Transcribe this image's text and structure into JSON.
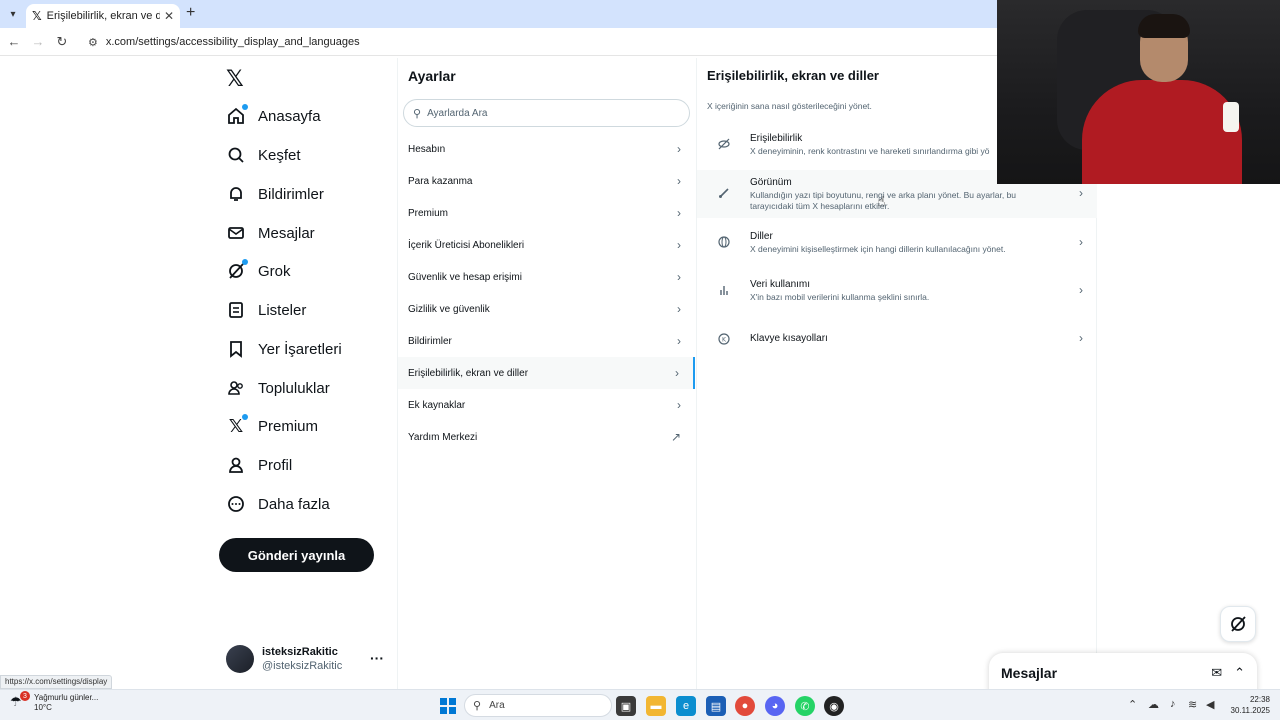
{
  "browser": {
    "tab_title": "Erişilebilirlik, ekran ve diller / X",
    "url": "x.com/settings/accessibility_display_and_languages",
    "status_url": "https://x.com/settings/display"
  },
  "sidebar": {
    "items": [
      {
        "label": "Anasayfa",
        "icon": "home-icon"
      },
      {
        "label": "Keşfet",
        "icon": "search-icon"
      },
      {
        "label": "Bildirimler",
        "icon": "bell-icon"
      },
      {
        "label": "Mesajlar",
        "icon": "mail-icon"
      },
      {
        "label": "Grok",
        "icon": "grok-icon"
      },
      {
        "label": "Listeler",
        "icon": "list-icon"
      },
      {
        "label": "Yer İşaretleri",
        "icon": "bookmark-icon"
      },
      {
        "label": "Topluluklar",
        "icon": "communities-icon"
      },
      {
        "label": "Premium",
        "icon": "x-logo-icon"
      },
      {
        "label": "Profil",
        "icon": "person-icon"
      },
      {
        "label": "Daha fazla",
        "icon": "more-circle-icon"
      }
    ],
    "post_button": "Gönderi yayınla",
    "account": {
      "name": "isteksizRakitic",
      "handle": "@isteksizRakitic"
    }
  },
  "settings": {
    "title": "Ayarlar",
    "search_placeholder": "Ayarlarda Ara",
    "items": [
      {
        "label": "Hesabın"
      },
      {
        "label": "Para kazanma"
      },
      {
        "label": "Premium"
      },
      {
        "label": "İçerik Üreticisi Abonelikleri"
      },
      {
        "label": "Güvenlik ve hesap erişimi"
      },
      {
        "label": "Gizlilik ve güvenlik"
      },
      {
        "label": "Bildirimler"
      },
      {
        "label": "Erişilebilirlik, ekran ve diller"
      },
      {
        "label": "Ek kaynaklar"
      },
      {
        "label": "Yardım Merkezi"
      }
    ],
    "active_index": 7
  },
  "detail": {
    "title": "Erişilebilirlik, ekran ve diller",
    "subtitle": "X içeriğinin sana nasıl gösterileceğini yönet.",
    "items": [
      {
        "label": "Erişilebilirlik",
        "desc": "X deneyiminin, renk kontrastını ve hareketi sınırlandırma gibi yö",
        "icon": "eye-slash-icon"
      },
      {
        "label": "Görünüm",
        "desc": "Kullandığın yazı tipi boyutunu, rengi ve arka planı yönet. Bu ayarlar, bu tarayıcıdaki tüm X hesaplarını etkiler.",
        "icon": "brush-icon"
      },
      {
        "label": "Diller",
        "desc": "X deneyimini kişiselleştirmek için hangi dillerin kullanılacağını yönet.",
        "icon": "globe-icon"
      },
      {
        "label": "Veri kullanımı",
        "desc": "X'in bazı mobil verilerini kullanma şeklini sınırla.",
        "icon": "chart-icon"
      },
      {
        "label": "Klavye kısayolları",
        "desc": "",
        "icon": "keyboard-icon"
      }
    ]
  },
  "messages_drawer": {
    "title": "Mesajlar"
  },
  "taskbar": {
    "weather_text": "Yağmurlu günler...",
    "weather_temp": "10°C",
    "weather_badge": "3",
    "search_placeholder": "Ara",
    "time": "22:38",
    "date": "30.11.2025"
  }
}
